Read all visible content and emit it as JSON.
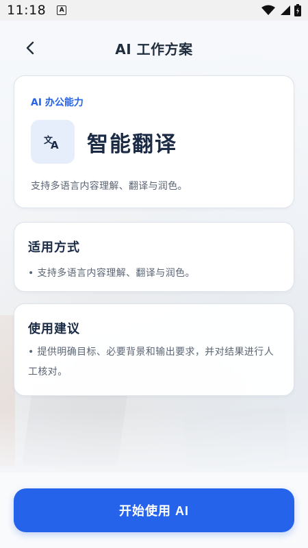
{
  "status_bar": {
    "time": "11:18",
    "notification_glyph": "A"
  },
  "header": {
    "title": "AI 工作方案"
  },
  "feature": {
    "eyebrow": "AI 办公能力",
    "icon": "translate-icon",
    "title": "智能翻译",
    "description": "支持多语言内容理解、翻译与润色。"
  },
  "usage": {
    "title": "适用方式",
    "body": "• 支持多语言内容理解、翻译与润色。"
  },
  "advice": {
    "title": "使用建议",
    "body": "• 提供明确目标、必要背景和输出要求，并对结果进行人工核对。"
  },
  "actions": {
    "start_label": "开始使用 AI"
  },
  "colors": {
    "accent": "#2563eb",
    "title_text": "#1a2a44",
    "body_text": "#5a6474"
  }
}
